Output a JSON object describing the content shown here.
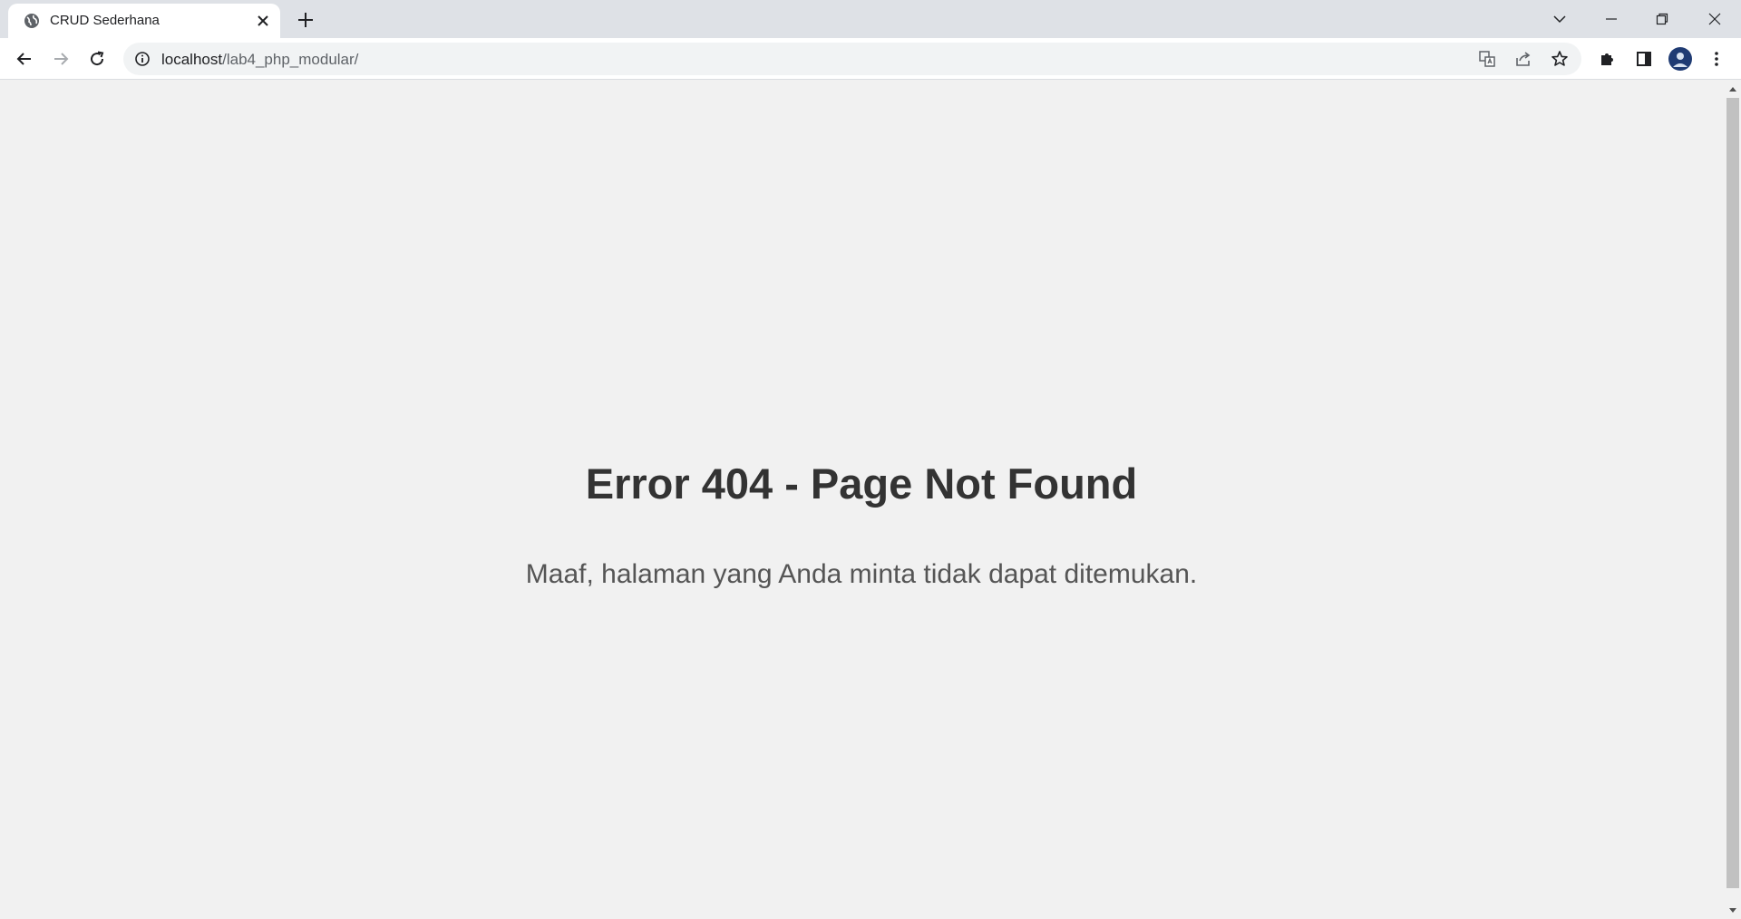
{
  "browser": {
    "tab": {
      "title": "CRUD Sederhana"
    },
    "address": {
      "host": "localhost",
      "path": "/lab4_php_modular/"
    }
  },
  "page": {
    "heading": "Error 404 - Page Not Found",
    "message": "Maaf, halaman yang Anda minta tidak dapat ditemukan."
  },
  "icons": {
    "favicon": "globe-icon",
    "tab_close": "close-icon",
    "new_tab": "plus-icon",
    "tab_search": "chevron-down-icon",
    "minimize": "minimize-icon",
    "restore": "restore-icon",
    "close_window": "close-icon",
    "back": "arrow-left-icon",
    "forward": "arrow-right-icon",
    "reload": "reload-icon",
    "site_info": "info-icon",
    "translate": "translate-icon",
    "share": "share-icon",
    "bookmark": "star-icon",
    "extensions": "puzzle-icon",
    "side_panel": "side-panel-icon",
    "profile": "avatar",
    "menu": "kebab-menu-icon"
  },
  "colors": {
    "page_background": "#f1f1f1",
    "heading_text": "#333333",
    "message_text": "#555555",
    "tabstrip": "#dee1e6"
  }
}
